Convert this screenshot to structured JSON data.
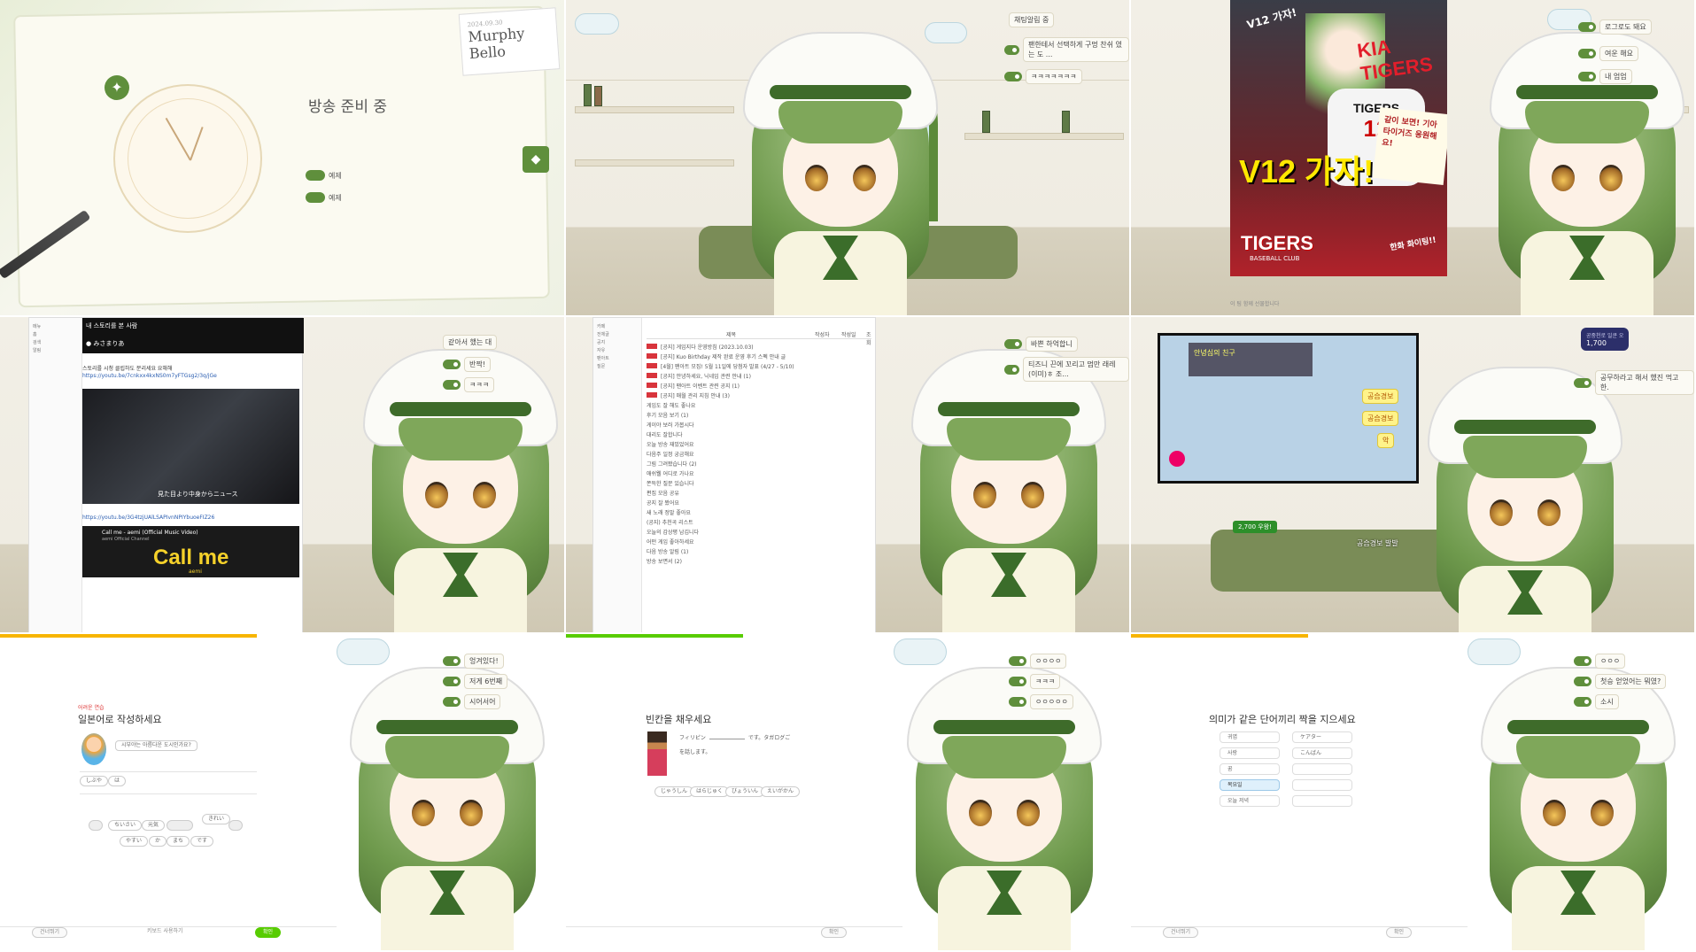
{
  "cell1": {
    "title": "방송 준비 중",
    "name": "Murphy Bello",
    "date": "2024.09.30",
    "options": [
      "예제",
      "예제"
    ]
  },
  "cell2": {
    "header": "채팅알림 중",
    "chats": [
      "팬한테서 선택하게 구멍 찬쉬 였는 도 ...",
      "ㅋㅋㅋㅋㅋㅋㅋ"
    ]
  },
  "cell3": {
    "poster": {
      "v12_small": "V12 가자!",
      "brand": "KIA TIGERS",
      "jersey_name": "TIGERS",
      "jersey_number": "12",
      "v12_big": "V12 가자!",
      "bottom": "TIGERS",
      "bottom_sub": "BASEBALL CLUB",
      "note": "같이 보면! 기아타이거즈 응원해요!",
      "cheer": "한화 화이팅!!",
      "caption": "이 팀 함께 선물합니다"
    },
    "chats": [
      "로그로도 돼요",
      "여운 해요",
      "내 엄엄"
    ]
  },
  "cell4": {
    "heading": "내 스토리를 본 사람",
    "account": "みさまりあ",
    "desc": "스토리를 시청 클립하도 분리세요 요해해",
    "link1": "https://youtu.be/7cnkxx4kxNS0m7yFTGsg2/3q/jGe",
    "video_caption": "見た目より中身からニュース",
    "link2": "https://youtu.be/3G4tzjUAlLSAPIvnNPIYbuoeFIZ26",
    "video2_title": "Call me - aemi (Official Music Video)",
    "video2_channel": "aemi Official Channel",
    "video2_banner": "Call me",
    "video2_sub": "aemi",
    "chats": [
      "같아서 했는 대",
      "반짝!",
      "ㅋㅋㅋ"
    ]
  },
  "cell5": {
    "columns": [
      "제목",
      "작성자",
      "작성일",
      "조회"
    ],
    "rows": [
      "[공지] 게임지다 운영방침 (2023.10.03)",
      "[공지] Kuo Birthday 제작 완료 운영 후기 스펙 안내 글",
      "[4월] 팬아트 모집! 5월 11일에 당첨자 발표 (4/27 - 5/10)",
      "[공지] 안녕하세요, 닉네임 관련 안내 (1)",
      "[공지] 팬아트 이벤트 관련 공지 (1)",
      "[공지] 매월 관리 지침 안내 (3)",
      "게임도 잘 해도 좋나요",
      "후기 모음 보기 (1)",
      "게이야 보러 가봅시다",
      "대리도 잘합니다",
      "오늘 방송 재밌었어요",
      "다음주 일정 궁금해요",
      "그림 그려봤습니다 (2)",
      "애쉬웰 어디로 가나요",
      "쫀득한 질문 있습니다",
      "편집 모음 공유",
      "공지 잘 봤어요",
      "새 노래 정말 좋아요",
      "(공지) 추천곡 리스트",
      "오늘의 감상평 남깁니다",
      "어떤 게임 좋아하세요",
      "다음 방송 알림 (1)",
      "방송 보면서 (2)"
    ],
    "chats": [
      "바쁜 하억합니",
      "티즈니 끈에 꼬리고 멈만 래레(이미)ㅎ 조..."
    ]
  },
  "cell6": {
    "donation_label": "공중천로 일쿤 오",
    "donation_amount": "1,700",
    "popup_title": "안녕심의 친구",
    "buttons": [
      "공습경보",
      "공습경보",
      "악"
    ],
    "chat_banner": "2,700 우왕!",
    "caption": "공습경보 발발",
    "chats": [
      "공무하라고 해서 했진 먹고 한."
    ]
  },
  "cell7": {
    "badge": "어려운 연습",
    "title": "일본어로 작성하세요",
    "prompt": "시부야는 아름다운 도시인가요?",
    "answer": [
      "しぶや",
      "は"
    ],
    "bank": [
      "ちいさい",
      "元気",
      "きれい",
      "やすい",
      "か",
      "まち",
      "です"
    ],
    "skip": "건너뛰기",
    "voice": "키보드 사용하기",
    "check": "확인",
    "chats": [
      "엉겨있다!",
      "저게 6번째",
      "시어서어"
    ]
  },
  "cell8": {
    "title": "빈칸을 채우세요",
    "sentence1": "フィリピン",
    "sentence1b": "です。タガログご",
    "sentence2": "を話します。",
    "choices": [
      "じゃうしん",
      "はらじゅく",
      "びょういん",
      "えいがかん"
    ],
    "check": "확인",
    "chats": [
      "ㅇㅇㅇㅇ",
      "ㅋㅋㅋ",
      "ㅇㅇㅇㅇㅇ"
    ]
  },
  "cell9": {
    "title": "의미가 같은 단어끼리 짝을 지으세요",
    "left": [
      "귀엽",
      "사랑",
      "꿈",
      "목요일",
      "오늘 저녁"
    ],
    "right": [
      "ケアター",
      "こんばん",
      "",
      "",
      ""
    ],
    "skip": "건너뛰기",
    "check": "확인",
    "chats": [
      "ㅇㅇㅇ",
      "첫승 얻었어는 뭐였?",
      "소시"
    ]
  }
}
